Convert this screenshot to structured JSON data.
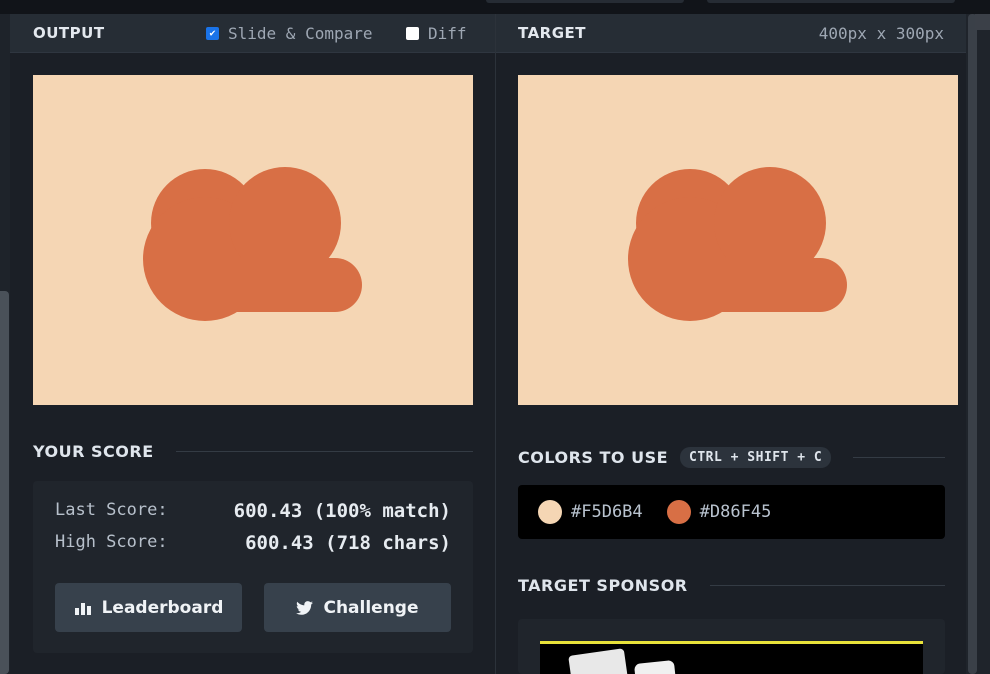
{
  "output_panel": {
    "title": "OUTPUT",
    "slide_compare_label": "Slide & Compare",
    "slide_compare_checked": true,
    "diff_label": "Diff",
    "diff_checked": false
  },
  "target_panel": {
    "title": "TARGET",
    "dimensions": "400px x 300px"
  },
  "colors": {
    "background": "#F5D6B4",
    "cloud": "#D86F45"
  },
  "score": {
    "title": "YOUR SCORE",
    "last_label": "Last Score:",
    "last_value": "600.43 (100% match)",
    "high_label": "High Score:",
    "high_value": "600.43 (718 chars)",
    "leaderboard_label": "Leaderboard",
    "challenge_label": "Challenge"
  },
  "colors_to_use": {
    "title": "COLORS TO USE",
    "shortcut": "CTRL + SHIFT + C",
    "swatches": [
      {
        "hex": "#F5D6B4"
      },
      {
        "hex": "#D86F45"
      }
    ]
  },
  "sponsor": {
    "title": "TARGET SPONSOR"
  }
}
